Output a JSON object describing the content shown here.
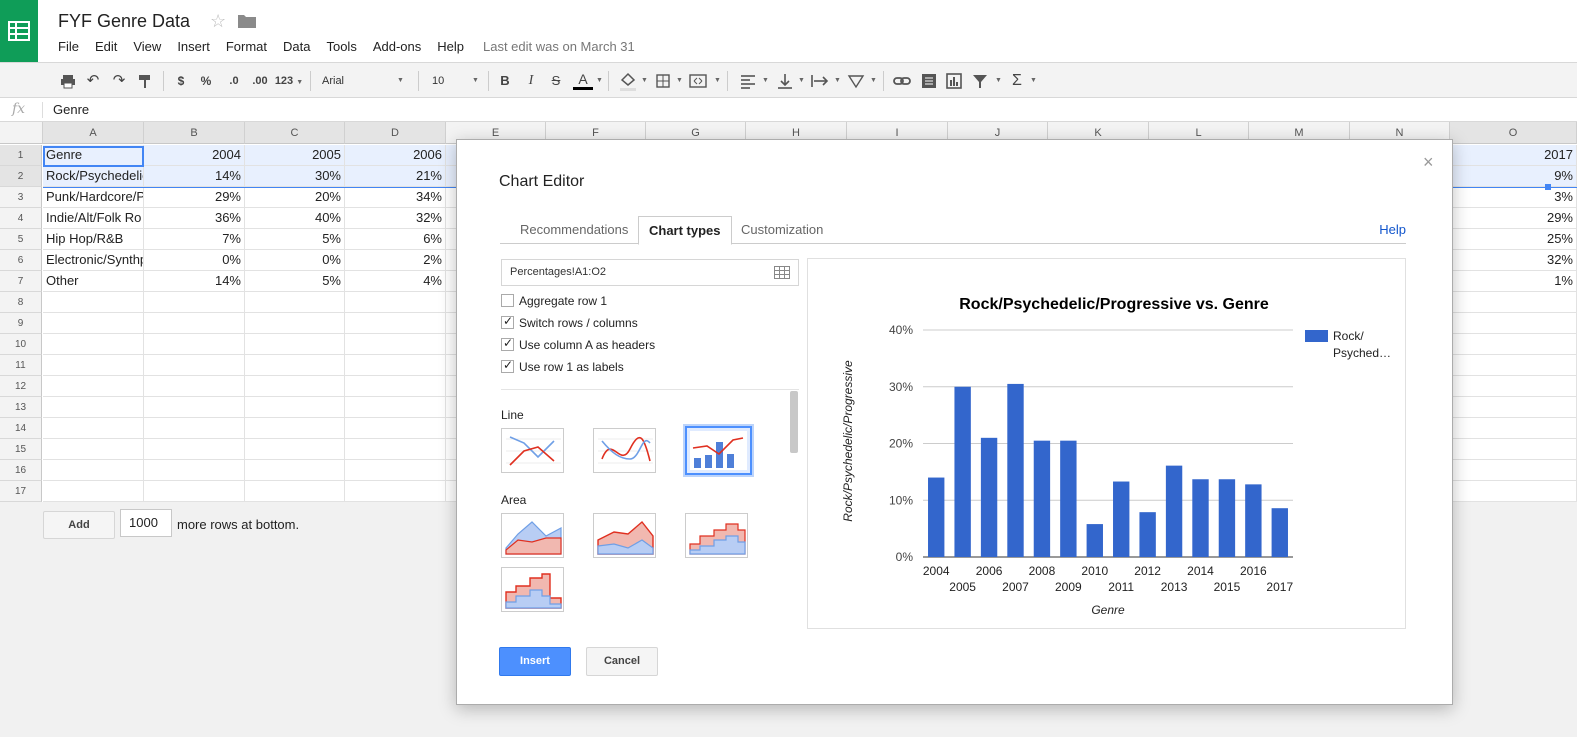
{
  "app": {
    "title": "FYF Genre Data",
    "last_edit": "Last edit was on March 31"
  },
  "menu": [
    "File",
    "Edit",
    "View",
    "Insert",
    "Format",
    "Data",
    "Tools",
    "Add-ons",
    "Help"
  ],
  "toolbar": {
    "currency": "$",
    "percent": "%",
    "decimal_less": ".0",
    "decimal_more": ".00",
    "more_formats": "123",
    "font": "Arial",
    "font_size": "10",
    "bold": "B",
    "italic": "I",
    "strike": "S",
    "text_color": "A"
  },
  "formula_bar": {
    "fx": "fx",
    "value": "Genre"
  },
  "grid": {
    "columns": [
      "A",
      "B",
      "C",
      "D",
      "E",
      "F",
      "G",
      "H",
      "I",
      "J",
      "K",
      "L",
      "M",
      "N",
      "O"
    ],
    "row_numbers": [
      "1",
      "2",
      "3",
      "4",
      "5",
      "6",
      "7",
      "8",
      "9",
      "10",
      "11",
      "12",
      "13",
      "14",
      "15",
      "16",
      "17"
    ],
    "rows": [
      [
        "Genre",
        "2004",
        "2005",
        "2006",
        "2017"
      ],
      [
        "Rock/Psychedelic",
        "14%",
        "30%",
        "21%",
        "9%"
      ],
      [
        "Punk/Hardcore/P",
        "29%",
        "20%",
        "34%",
        "3%"
      ],
      [
        "Indie/Alt/Folk Ro",
        "36%",
        "40%",
        "32%",
        "29%"
      ],
      [
        "Hip Hop/R&B",
        "7%",
        "5%",
        "6%",
        "25%"
      ],
      [
        "Electronic/Synthp",
        "0%",
        "0%",
        "2%",
        "32%"
      ],
      [
        "Other",
        "14%",
        "5%",
        "4%",
        "1%"
      ]
    ],
    "add_label": "Add",
    "add_rows_value": "1000",
    "add_rows_suffix": "more rows at bottom."
  },
  "dialog": {
    "title": "Chart Editor",
    "close": "×",
    "tabs": [
      "Recommendations",
      "Chart types",
      "Customization"
    ],
    "active_tab": "Chart types",
    "help": "Help",
    "range": "Percentages!A1:O2",
    "options": [
      {
        "label": "Aggregate row 1",
        "checked": false
      },
      {
        "label": "Switch rows / columns",
        "checked": true
      },
      {
        "label": "Use column A as headers",
        "checked": true
      },
      {
        "label": "Use row 1 as labels",
        "checked": true
      }
    ],
    "groups": [
      "Line",
      "Area"
    ],
    "insert": "Insert",
    "cancel": "Cancel"
  },
  "colors": {
    "accent": "#4d90fe",
    "bar": "#3366cc",
    "line_red": "#dc3912",
    "sheets_green": "#0f9d58"
  },
  "chart_data": {
    "type": "bar",
    "title": "Rock/Psychedelic/Progressive vs. Genre",
    "xlabel": "Genre",
    "ylabel": "Rock/Psychedelic/Progressive",
    "categories": [
      "2004",
      "2005",
      "2006",
      "2007",
      "2008",
      "2009",
      "2010",
      "2011",
      "2012",
      "2013",
      "2014",
      "2015",
      "2016",
      "2017"
    ],
    "series": [
      {
        "name": "Rock/Psyched…",
        "values": [
          14,
          30,
          21,
          30.5,
          20.5,
          20.5,
          5.8,
          13.3,
          7.9,
          16.1,
          13.7,
          13.7,
          12.8,
          8.6
        ]
      }
    ],
    "yticks": [
      "0%",
      "10%",
      "20%",
      "30%",
      "40%"
    ],
    "ylim": [
      0,
      40
    ],
    "legend": [
      "Rock/",
      "Psyched…"
    ],
    "legend_position": "right",
    "grid": true
  }
}
